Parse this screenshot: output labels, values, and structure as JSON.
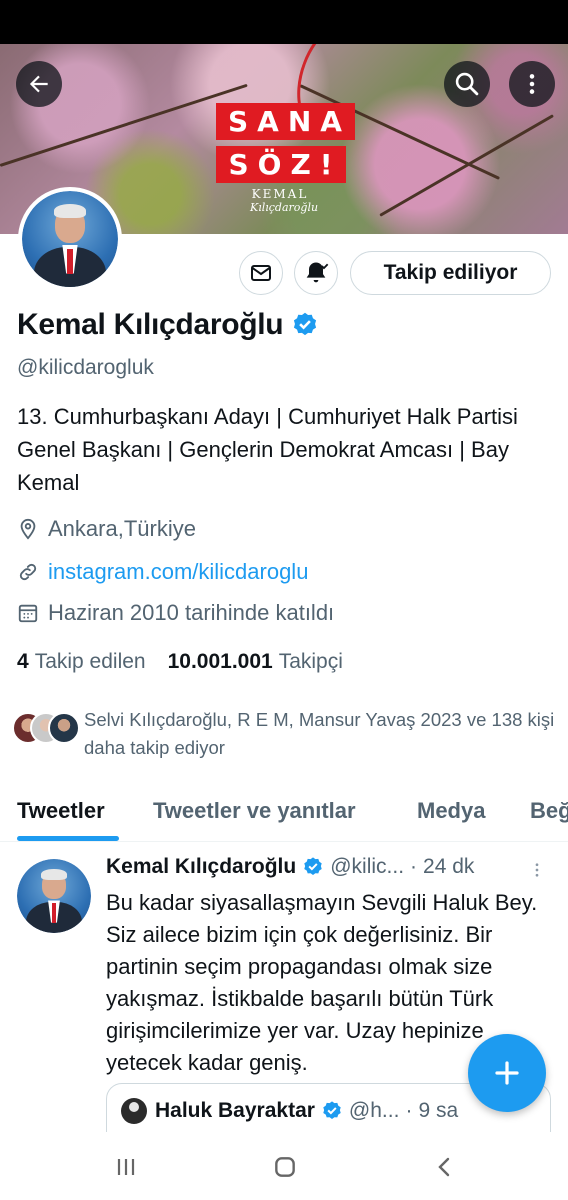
{
  "banner": {
    "title_line1": "SANA",
    "title_line2": "SÖZ!",
    "sign_top": "KEMAL",
    "sign_bottom": "Kılıçdaroğlu"
  },
  "profile": {
    "name": "Kemal Kılıçdaroğlu",
    "handle": "@kilicdarogluk",
    "bio": "13. Cumhurbaşkanı Adayı | Cumhuriyet Halk Partisi Genel Başkanı | Gençlerin Demokrat Amcası | Bay Kemal",
    "location": "Ankara,Türkiye",
    "link": "instagram.com/kilicdaroglu",
    "joined": "Haziran 2010 tarihinde katıldı",
    "following_count": "4",
    "following_label": "Takip edilen",
    "followers_count": "10.001.001",
    "followers_label": "Takipçi",
    "follow_button": "Takip ediliyor",
    "followed_by_text": "Selvi Kılıçdaroğlu, R E M, Mansur Yavaş 2023 ve 138 kişi daha takip ediyor"
  },
  "tabs": [
    {
      "label": "Tweetler"
    },
    {
      "label": "Tweetler ve yanıtlar"
    },
    {
      "label": "Medya"
    },
    {
      "label": "Beğ"
    }
  ],
  "tweet": {
    "name": "Kemal Kılıçdaroğlu",
    "handle": "@kilic...",
    "separator": "·",
    "time": "24 dk",
    "text": "Bu kadar siyasallaşmayın Sevgili Haluk Bey. Siz ailece bizim için çok değerlisiniz. Bir partinin seçim propagandası olmak size yakışmaz. İstikbalde başarılı bütün Türk girişimcilerimize yer var. Uzay hepinize yetecek kadar geniş.",
    "quote": {
      "name": "Haluk Bayraktar",
      "handle": "@h...",
      "separator": "·",
      "time": "9 sa"
    }
  },
  "colors": {
    "accent": "#1d9bf0",
    "text_primary": "#0f1419",
    "text_secondary": "#536471",
    "banner_red": "#e01b22"
  },
  "icons": {
    "back": "arrow-left-icon",
    "search": "search-icon",
    "more": "more-vertical-icon",
    "message": "envelope-icon",
    "notifications": "bell-check-icon",
    "verified": "verified-badge-icon",
    "location": "location-pin-icon",
    "link": "link-icon",
    "calendar": "calendar-icon",
    "compose": "plus-icon"
  }
}
